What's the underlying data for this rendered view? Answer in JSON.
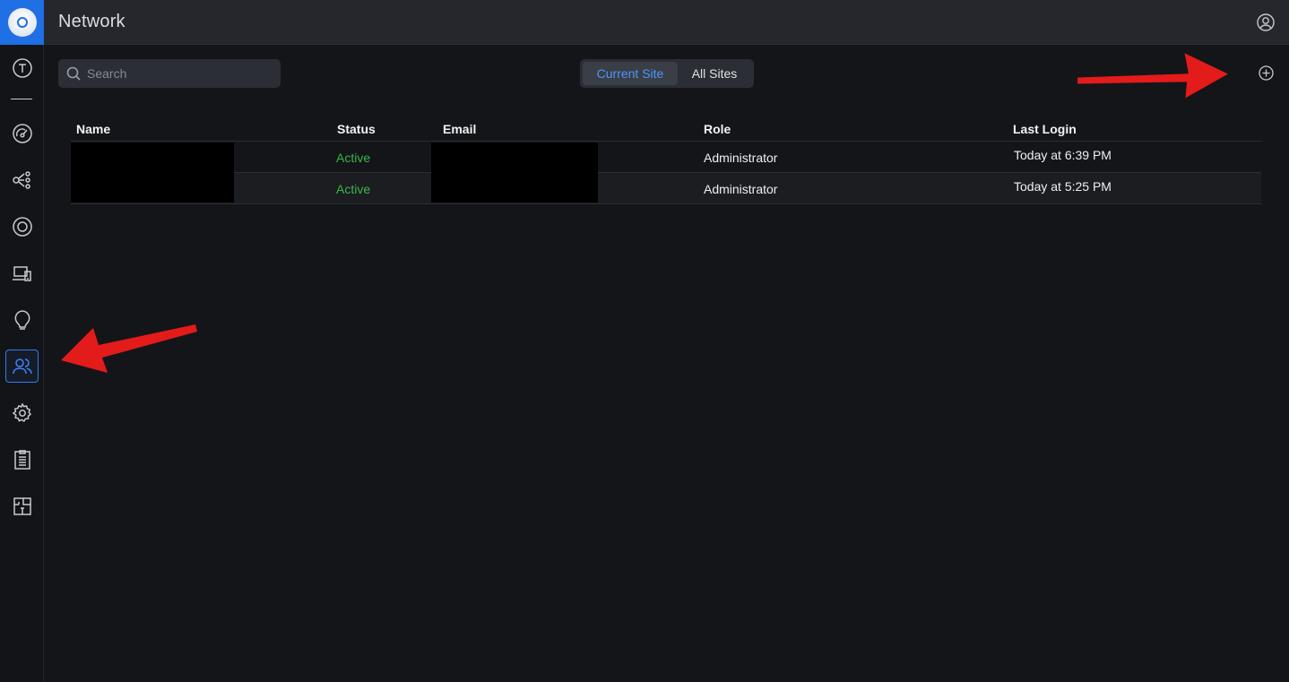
{
  "header": {
    "title": "Network"
  },
  "sidebar": {
    "items": [
      {
        "name": "topology",
        "icon": "letter-t-circle-icon"
      },
      {
        "name": "dashboard",
        "icon": "gauge-icon"
      },
      {
        "name": "topology-map",
        "icon": "topology-icon"
      },
      {
        "name": "devices",
        "icon": "target-circle-icon"
      },
      {
        "name": "clients",
        "icon": "devices-icon"
      },
      {
        "name": "insights",
        "icon": "lightbulb-icon"
      },
      {
        "name": "admins",
        "icon": "users-icon",
        "active": true
      },
      {
        "name": "settings",
        "icon": "gear-icon"
      },
      {
        "name": "logs",
        "icon": "clipboard-list-icon"
      },
      {
        "name": "floorplan",
        "icon": "floorplan-icon"
      }
    ]
  },
  "toolbar": {
    "search_placeholder": "Search",
    "scope_tabs": [
      {
        "label": "Current Site",
        "active": true
      },
      {
        "label": "All Sites",
        "active": false
      }
    ],
    "add_icon": "plus-circle-icon"
  },
  "table": {
    "columns": [
      "Name",
      "Status",
      "Email",
      "Role",
      "Last Login"
    ],
    "rows": [
      {
        "name": "",
        "status": "Active",
        "email": "",
        "role": "Administrator",
        "last_login": "Today at 6:39 PM"
      },
      {
        "name": "",
        "status": "Active",
        "email": "",
        "role": "Administrator",
        "last_login": "Today at 5:25 PM"
      }
    ]
  },
  "colors": {
    "accent": "#2e7cf6",
    "status_active": "#39b54a",
    "annotation_arrow": "#e31b1b",
    "background": "#141518"
  }
}
